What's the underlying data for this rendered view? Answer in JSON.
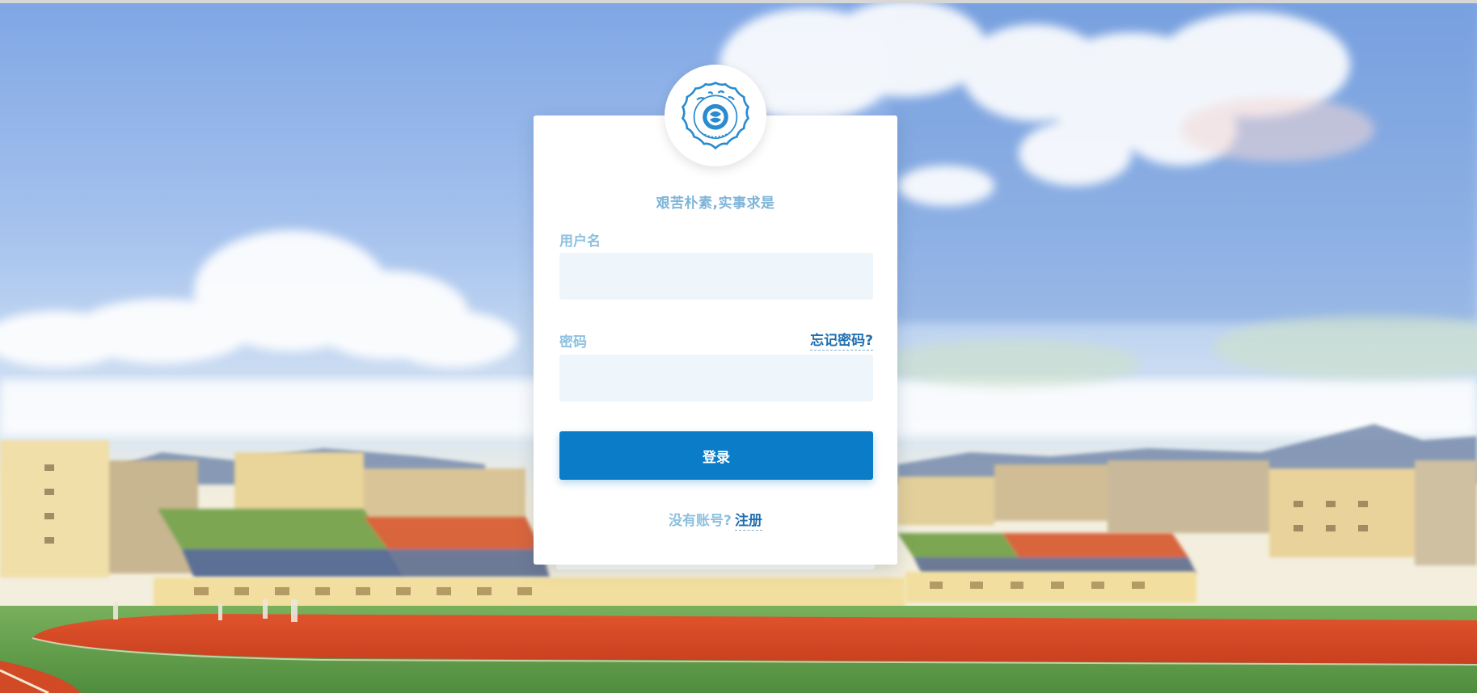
{
  "header": {
    "logo_ring_text": "NO HAI UNIVERSITY",
    "logo_year": "1915",
    "logo_icon": "university-seal-icon"
  },
  "login": {
    "motto": "艰苦朴素,实事求是",
    "username_label": "用户名",
    "username_value": "",
    "username_placeholder": "",
    "password_label": "密码",
    "password_value": "",
    "password_placeholder": "",
    "forgot_label": "忘记密码?",
    "submit_label": "登录",
    "no_account_label": "没有账号?",
    "register_label": "注册"
  },
  "colors": {
    "accent": "#0a7cc8",
    "label": "#8ec0df",
    "link": "#1f6fb0",
    "input_bg": "#eef6fb"
  }
}
